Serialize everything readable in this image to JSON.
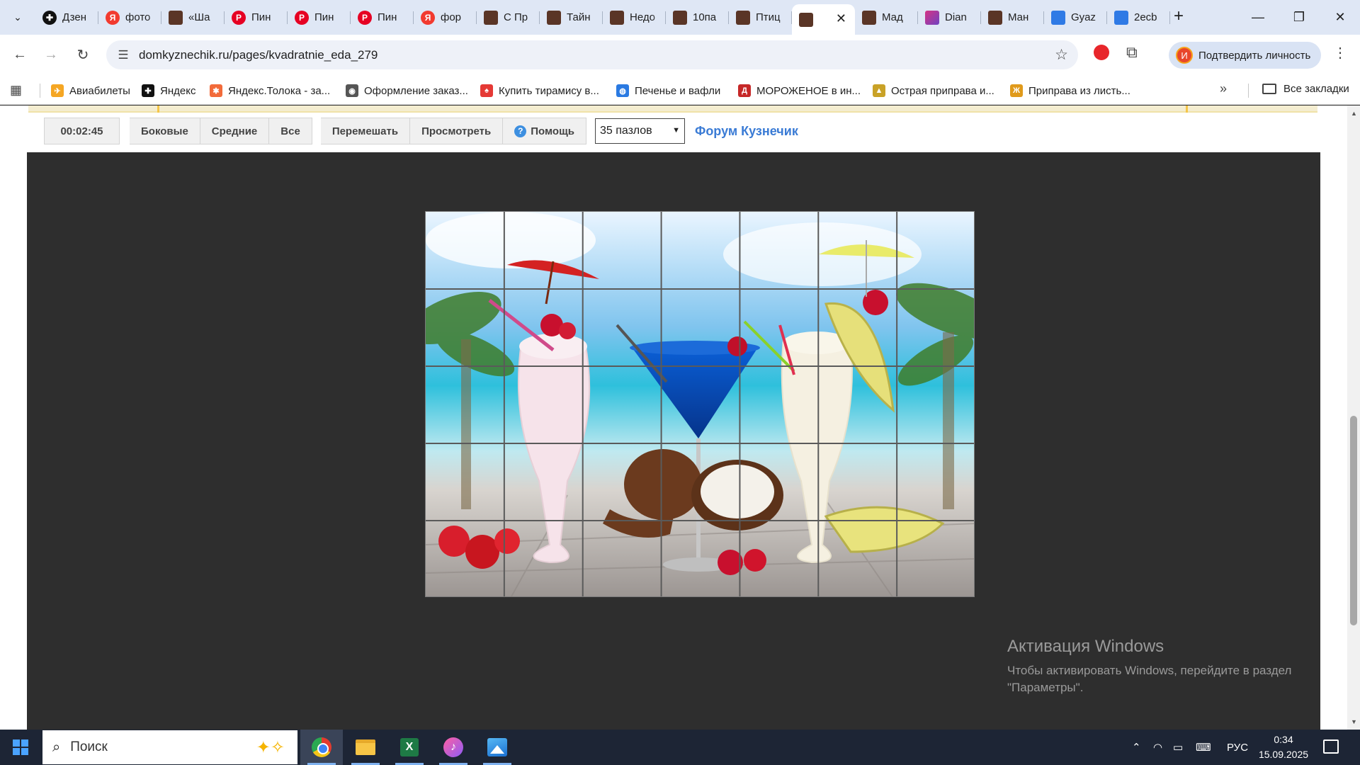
{
  "browser": {
    "tabs": [
      {
        "title": "Дзен",
        "icon": "dzen-icon",
        "favicon": "dzen"
      },
      {
        "title": "фото",
        "icon": "yandex-icon",
        "favicon": "ya"
      },
      {
        "title": "«Ша",
        "icon": "image-favicon-icon",
        "favicon": "img"
      },
      {
        "title": "Пин",
        "icon": "pinterest-icon",
        "favicon": "pin"
      },
      {
        "title": "Пин",
        "icon": "pinterest-icon",
        "favicon": "pin"
      },
      {
        "title": "Пин",
        "icon": "pinterest-icon",
        "favicon": "pin"
      },
      {
        "title": "фор",
        "icon": "yandex-icon",
        "favicon": "ya"
      },
      {
        "title": "С Пр",
        "icon": "image-favicon-icon",
        "favicon": "img"
      },
      {
        "title": "Тайн",
        "icon": "image-favicon-icon",
        "favicon": "img"
      },
      {
        "title": "Недо",
        "icon": "image-favicon-icon",
        "favicon": "img"
      },
      {
        "title": "10па",
        "icon": "image-favicon-icon",
        "favicon": "img"
      },
      {
        "title": "Птиц",
        "icon": "image-favicon-icon",
        "favicon": "img"
      },
      {
        "title": "",
        "icon": "image-favicon-icon",
        "favicon": "img",
        "active": true
      },
      {
        "title": "Мад",
        "icon": "image-favicon-icon",
        "favicon": "img"
      },
      {
        "title": "Dian",
        "icon": "diana-icon",
        "favicon": "diana"
      },
      {
        "title": "Ман",
        "icon": "image-favicon-icon",
        "favicon": "img"
      },
      {
        "title": "Gyaz",
        "icon": "gyazo-icon",
        "favicon": "gyaz"
      },
      {
        "title": "2ecb",
        "icon": "gyazo-icon",
        "favicon": "gyaz"
      }
    ],
    "url": "domkyznechik.ru/pages/kvadratnie_eda_279",
    "profile_label": "Подтвердить личность",
    "profile_initial": "И"
  },
  "bookmarks": {
    "items": [
      {
        "label": "Авиабилеты",
        "color": "#f5a623",
        "glyph": "✈"
      },
      {
        "label": "Яндекс",
        "color": "#111111",
        "glyph": "✚"
      },
      {
        "label": "Яндекс.Толока - за...",
        "color": "#f26b3a",
        "glyph": "✱"
      },
      {
        "label": "Оформление заказ...",
        "color": "#555555",
        "glyph": "◉"
      },
      {
        "label": "Купить тирамису в...",
        "color": "#e53935",
        "glyph": "♠"
      },
      {
        "label": "Печенье и вафли",
        "color": "#2a7ae2",
        "glyph": "◍"
      },
      {
        "label": "МОРОЖЕНОЕ в ин...",
        "color": "#c62828",
        "glyph": "Д"
      },
      {
        "label": "Острая приправа и...",
        "color": "#c9a227",
        "glyph": "▲"
      },
      {
        "label": "Приправа из листь...",
        "color": "#e09a1b",
        "glyph": "Ж"
      }
    ],
    "all_label": "Все закладки"
  },
  "puzzle_page": {
    "timer": "00:02:45",
    "btn_sides": "Боковые",
    "btn_middle": "Средние",
    "btn_all": "Все",
    "btn_shuffle": "Перемешать",
    "btn_view": "Просмотреть",
    "btn_help": "Помощь",
    "pieces_select": "35 пазлов",
    "forum_link": "Форум Кузнечик",
    "grid": {
      "cols": 7,
      "rows": 5
    }
  },
  "watermark": {
    "title": "Активация Windows",
    "line1": "Чтобы активировать Windows, перейдите в раздел",
    "line2": "\"Параметры\"."
  },
  "taskbar": {
    "search_placeholder": "Поиск",
    "language": "РУС",
    "time": "0:34",
    "date": "15.09.2025"
  },
  "colors": {
    "accent_link": "#3a7bd5",
    "board_bg": "#2e2e2e",
    "taskbar_bg": "#1d2535"
  }
}
